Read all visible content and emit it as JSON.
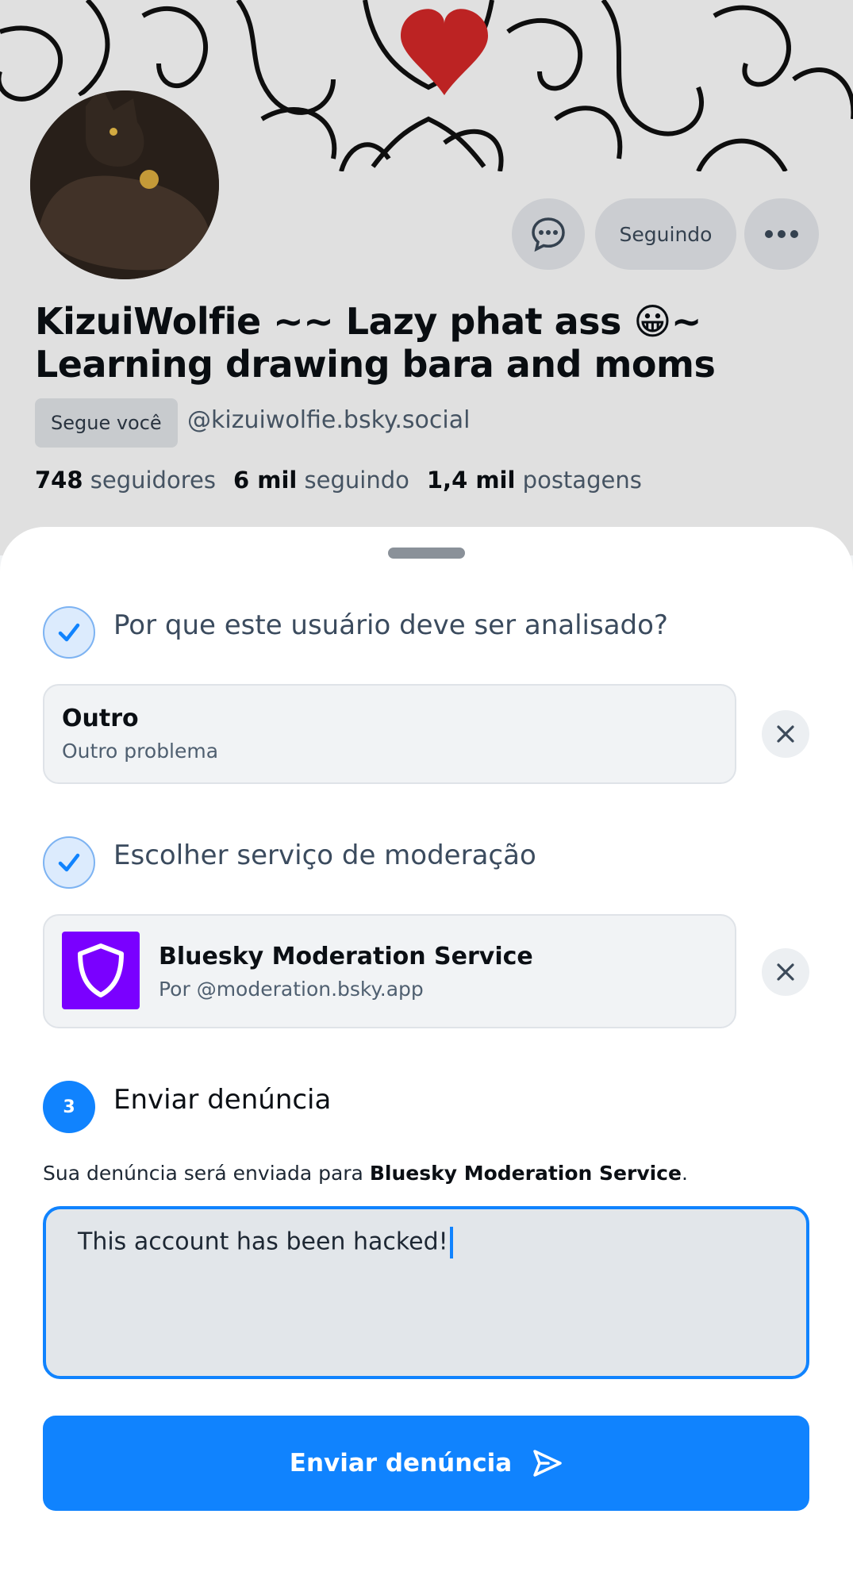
{
  "profile": {
    "follow_label": "Seguindo",
    "display_name": "KizuiWolfie ~~ Lazy phat ass 😀~ Learning drawing bara and moms",
    "follows_you_label": "Segue você",
    "handle": "@kizuiwolfie.bsky.social",
    "stats": {
      "followers_count": "748",
      "followers_label": "seguidores",
      "following_count": "6 mil",
      "following_label": "seguindo",
      "posts_count": "1,4 mil",
      "posts_label": "postagens"
    },
    "icons": {
      "message": "chat-bubble-dots-icon",
      "more": "more-horizontal-icon"
    }
  },
  "report": {
    "step1": {
      "title": "Por que este usuário deve ser analisado?",
      "status": "completed",
      "selection": {
        "title": "Outro",
        "subtitle": "Outro problema"
      }
    },
    "step2": {
      "title": "Escolher serviço de moderação",
      "status": "completed",
      "selection": {
        "title": "Bluesky Moderation Service",
        "subtitle": "Por @moderation.bsky.app"
      }
    },
    "step3": {
      "number": "3",
      "title": "Enviar denúncia",
      "status": "active",
      "info_prefix": "Sua denúncia será enviada para ",
      "info_service": "Bluesky Moderation Service",
      "info_suffix": ".",
      "input_value": "This account has been hacked!",
      "submit_label": "Enviar denúncia"
    }
  },
  "colors": {
    "accent": "#1083fe",
    "moderation_logo": "#7a00ff",
    "heart": "#d62828"
  }
}
